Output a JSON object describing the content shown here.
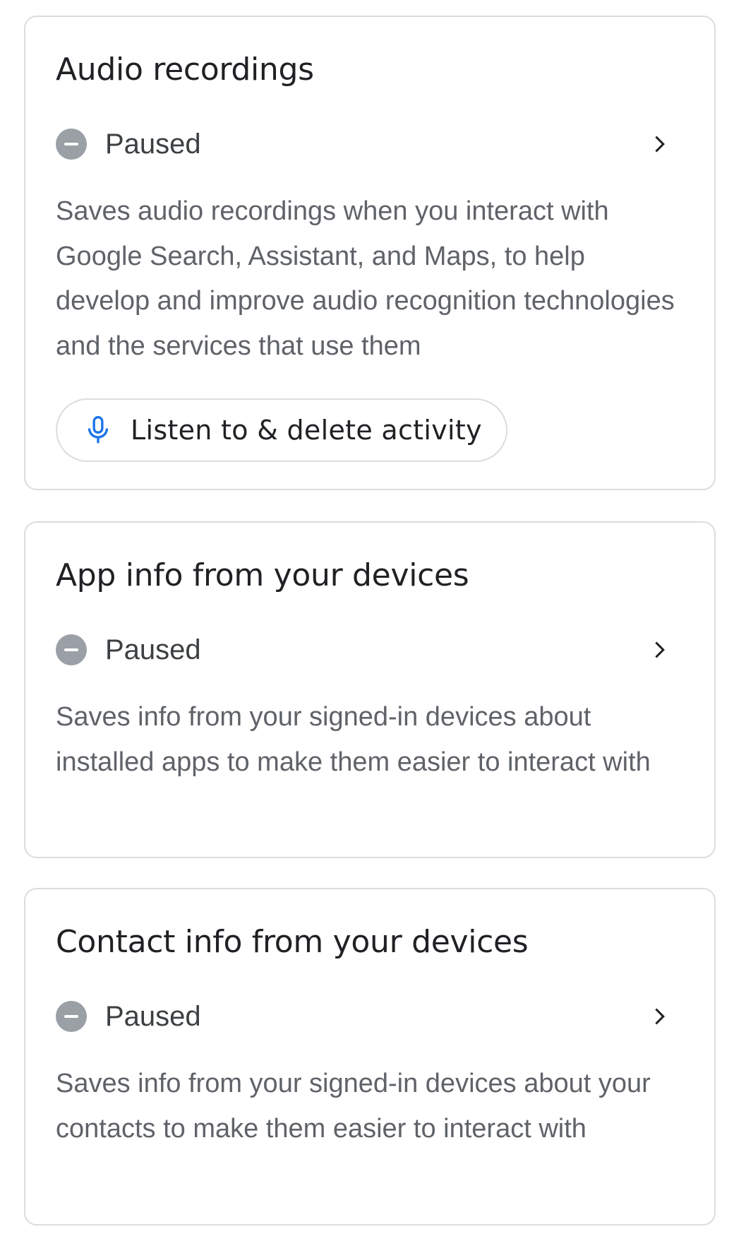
{
  "cards": [
    {
      "title": "Audio recordings",
      "status": "Paused",
      "status_icon": "paused-icon",
      "description": "Saves audio recordings when you interact with Google Search, Assistant, and Maps, to help develop and improve audio recognition technologies and the services that use them",
      "action": {
        "label": "Listen to & delete activity",
        "icon": "mic-icon"
      }
    },
    {
      "title": "App info from your devices",
      "status": "Paused",
      "status_icon": "paused-icon",
      "description": "Saves info from your signed-in devices about installed apps to make them easier to interact with"
    },
    {
      "title": "Contact info from your devices",
      "status": "Paused",
      "status_icon": "paused-icon",
      "description": "Saves info from your signed-in devices about your contacts to make them easier to interact with"
    }
  ],
  "colors": {
    "card_border": "#dadce0",
    "status_icon": "#9aa0a6",
    "mic_icon": "#1a73e8",
    "title_text": "#202124",
    "description_text": "#5f6368"
  }
}
